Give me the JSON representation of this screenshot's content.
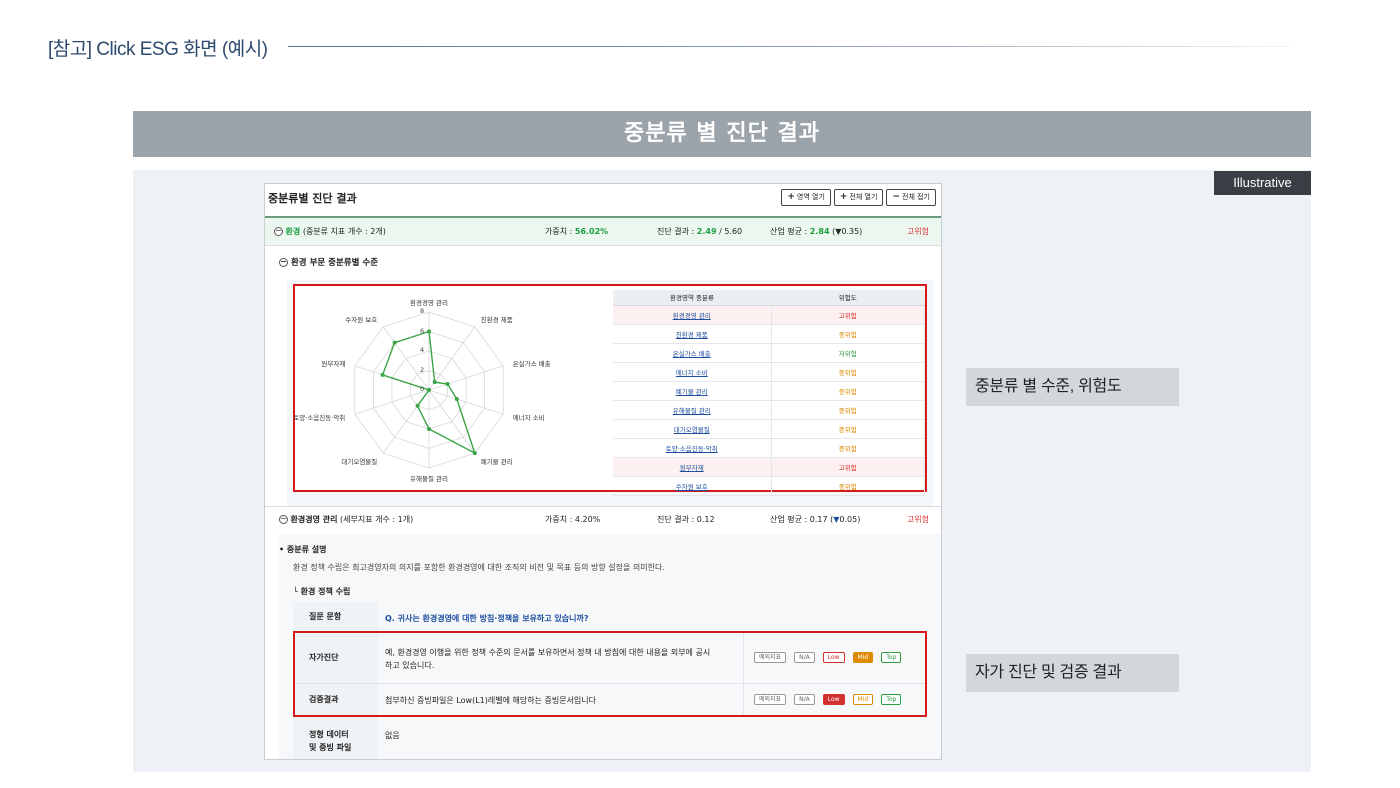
{
  "slide": {
    "title": "[참고] Click ESG 화면 (예시)",
    "banner": "중분류 별 진단 결과",
    "illustrative": "Illustrative",
    "callout_1": "중분류 별 수준, 위험도",
    "callout_2": "자가 진단 및 검증 결과"
  },
  "screen": {
    "title": "중분류별 진단 결과",
    "buttons": {
      "expand_area": "영역 열기",
      "expand_all": "전체 열기",
      "collapse_all": "전체 접기",
      "plus": "+",
      "minus": "−"
    },
    "environment_row": {
      "label": "환경",
      "meta": "(중분류 지표 개수 : 2개)",
      "weight_label": "가중치 :",
      "weight_value": "56.02%",
      "result_label": "진단 결과 :",
      "result_value": "2.49",
      "result_max": "/ 5.60",
      "avg_label": "산업 평균 :",
      "avg_value": "2.84",
      "avg_delta": "(▼0.35)",
      "risk": "고위험"
    },
    "sub_heading": "환경 부문 중분류별 수준",
    "radar": {
      "axes": [
        "환경경영 관리",
        "친환경 제품",
        "온실가스 배출",
        "에너지 소비",
        "폐기물 관리",
        "유해물질 관리",
        "대기오염물질",
        "토양·소음진동·악취",
        "원부자재",
        "수자원 보호"
      ],
      "ticks": [
        "8",
        "6",
        "4",
        "2",
        "0"
      ],
      "max": 8,
      "values": [
        6,
        1,
        2,
        3,
        8,
        4,
        2,
        0,
        5,
        6
      ],
      "line_color": "#3aa447"
    },
    "category_table": {
      "headers": [
        "환경영역 중분류",
        "위험도"
      ],
      "rows": [
        {
          "name": "환경경영 관리",
          "risk": "고위험",
          "level": "high"
        },
        {
          "name": "친환경 제품",
          "risk": "중위험",
          "level": "mid"
        },
        {
          "name": "온실가스 배출",
          "risk": "저위험",
          "level": "low"
        },
        {
          "name": "에너지 소비",
          "risk": "중위험",
          "level": "mid"
        },
        {
          "name": "폐기물 관리",
          "risk": "중위험",
          "level": "mid"
        },
        {
          "name": "유해물질 관리",
          "risk": "중위험",
          "level": "mid"
        },
        {
          "name": "대기오염물질",
          "risk": "중위험",
          "level": "mid"
        },
        {
          "name": "토양·소음진동·악취",
          "risk": "중위험",
          "level": "mid"
        },
        {
          "name": "원부자재",
          "risk": "고위험",
          "level": "high"
        },
        {
          "name": "수자원 보호",
          "risk": "중위험",
          "level": "mid"
        }
      ]
    },
    "mgmt_row": {
      "label": "환경경영 관리",
      "meta": "(세부지표 개수 : 1개)",
      "weight": "가중치 : 4.20%",
      "result": "진단 결과 : 0.12",
      "avg_prefix": "산업 평균 : 0.17 (",
      "avg_arrow": "▼",
      "avg_delta": "0.05)",
      "risk": "고위험"
    },
    "description": {
      "heading": "• 중분류 설명",
      "text": "환경 정책 수립은 최고경영자의 의지를 포함한 환경경영에 대한 조직의 비전 및 목표 등의 방향 설정을 의미한다.",
      "policy_heading": "└ 환경 정책 수립"
    },
    "qa": {
      "question_label": "질문 문항",
      "question": "Q. 귀사는 환경경영에 대한 방침·정책을 보유하고 있습니까?",
      "self_label": "자가진단",
      "self_answer_1": "예, 환경경영 이행을 위한 정책 수준의 문서를 보유하면서 정책 내 방침에 대한 내용을 외부에 공시",
      "self_answer_2": "하고 있습니다.",
      "verify_label": "검증결과",
      "verify_answer": "첨부하신 증빙파일은 Low(L1)레벨에 해당하는 증빙문서입니다",
      "data_label_1": "정형 데이터",
      "data_label_2": "및 증빙 파일",
      "data_value": "없음",
      "levels": [
        "예외지표",
        "N/A",
        "Low",
        "Mid",
        "Top"
      ]
    }
  }
}
